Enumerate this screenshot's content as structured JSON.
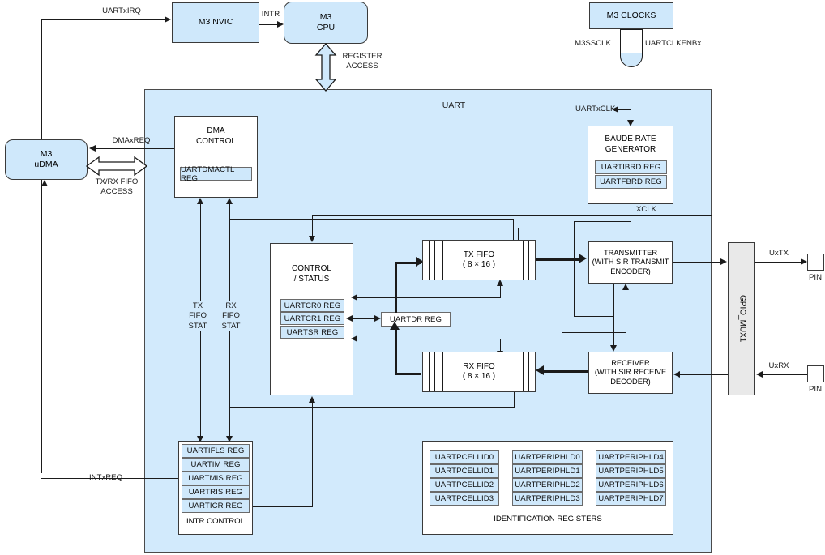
{
  "diagram": {
    "title": "UART",
    "region_label": "UART"
  },
  "blocks": {
    "m3_nvic": "M3 NVIC",
    "m3_cpu": "M3\nCPU",
    "m3_clocks": "M3 CLOCKS",
    "m3_udma": "M3\nuDMA",
    "dma_control": "DMA\nCONTROL",
    "baud_rate_generator": "BAUDE RATE\nGENERATOR",
    "control_status": "CONTROL\n/ STATUS",
    "tx_fifo": "TX FIFO\n( 8 × 16 )",
    "rx_fifo": "RX FIFO\n( 8 × 16 )",
    "transmitter": "TRANSMITTER\n(WITH SIR TRANSMIT\nENCODER)",
    "receiver": "RECEIVER\n(WITH SIR RECEIVE\nDECODER)",
    "gpio_mux": "GPIO_MUX1",
    "intr_control": "INTR CONTROL",
    "identification_registers": "IDENTIFICATION REGISTERS",
    "pin_tx": "PIN",
    "pin_rx": "PIN"
  },
  "registers": {
    "uartdmactl": "UARTDMACTL REG",
    "uartibrd": "UARTIBRD REG",
    "uartfbrd": "UARTFBRD REG",
    "uartcr0": "UARTCR0 REG",
    "uartcr1": "UARTCR1 REG",
    "uartsr": "UARTSR REG",
    "uartdr": "UARTDR REG",
    "intr": [
      "UARTIFLS REG",
      "UARTIM REG",
      "UARTMIS REG",
      "UARTRIS REG",
      "UARTICR REG"
    ],
    "ident_col1": [
      "UARTPCELLID0",
      "UARTPCELLID1",
      "UARTPCELLID2",
      "UARTPCELLID3"
    ],
    "ident_col2": [
      "UARTPERIPHLD0",
      "UARTPERIPHLD1",
      "UARTPERIPHLD2",
      "UARTPERIPHLD3"
    ],
    "ident_col3": [
      "UARTPERIPHLD4",
      "UARTPERIPHLD5",
      "UARTPERIPHLD6",
      "UARTPERIPHLD7"
    ]
  },
  "signals": {
    "uartxirq": "UARTxIRQ",
    "intr": "INTR",
    "register_access": "REGISTER\nACCESS",
    "m3ssclk": "M3SSCLK",
    "uartclkenbx": "UARTCLKENBx",
    "uartxclk": "UARTxCLK",
    "xclk": "XCLK",
    "dmaxreq": "DMAxREQ",
    "txrx_fifo_access": "TX/RX FIFO\nACCESS",
    "tx_fifo_stat": "TX\nFIFO\nSTAT",
    "rx_fifo_stat": "RX\nFIFO\nSTAT",
    "intxreq": "INTxREQ",
    "uxtx": "UxTX",
    "uxrx": "UxRX"
  },
  "colors": {
    "region_fill": "#d2eafc",
    "block_fill": "#cfe8fb",
    "white_fill": "#ffffff",
    "gray_fill": "#e9e9e9",
    "line": "#1b1b1b"
  }
}
